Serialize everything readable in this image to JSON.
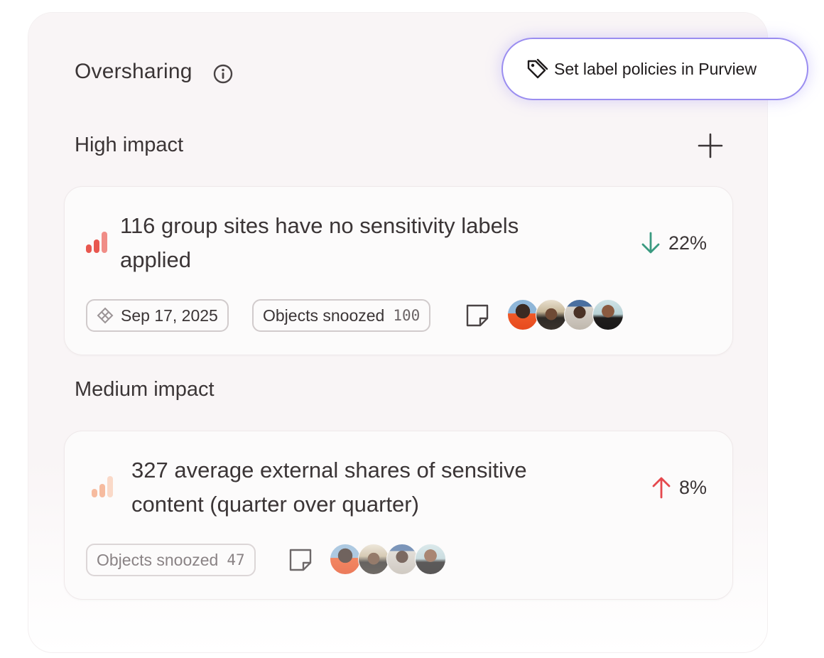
{
  "header": {
    "title": "Oversharing"
  },
  "purview_button": {
    "label": "Set label policies in Purview"
  },
  "sections": {
    "high": {
      "title": "High impact"
    },
    "medium": {
      "title": "Medium impact"
    }
  },
  "cards": {
    "high": {
      "title_line1": "116 group sites have no sensitivity labels",
      "title_line2": "applied",
      "trend": {
        "direction": "down",
        "value": "22%",
        "color": "#3a9a80"
      },
      "date": "Sep 17, 2025",
      "snoozed_label": "Objects snoozed",
      "snoozed_count": "100",
      "bar_color": "#e8574f"
    },
    "medium": {
      "title_line1": "327 average external shares of sensitive",
      "title_line2": "content (quarter over quarter)",
      "trend": {
        "direction": "up",
        "value": "8%",
        "color": "#e5484d"
      },
      "snoozed_label": "Objects snoozed",
      "snoozed_count": "47",
      "bar_color": "#f4b79b"
    }
  },
  "colors": {
    "accent_border": "#9a8df0",
    "panel_bg": "#f9f5f6"
  }
}
